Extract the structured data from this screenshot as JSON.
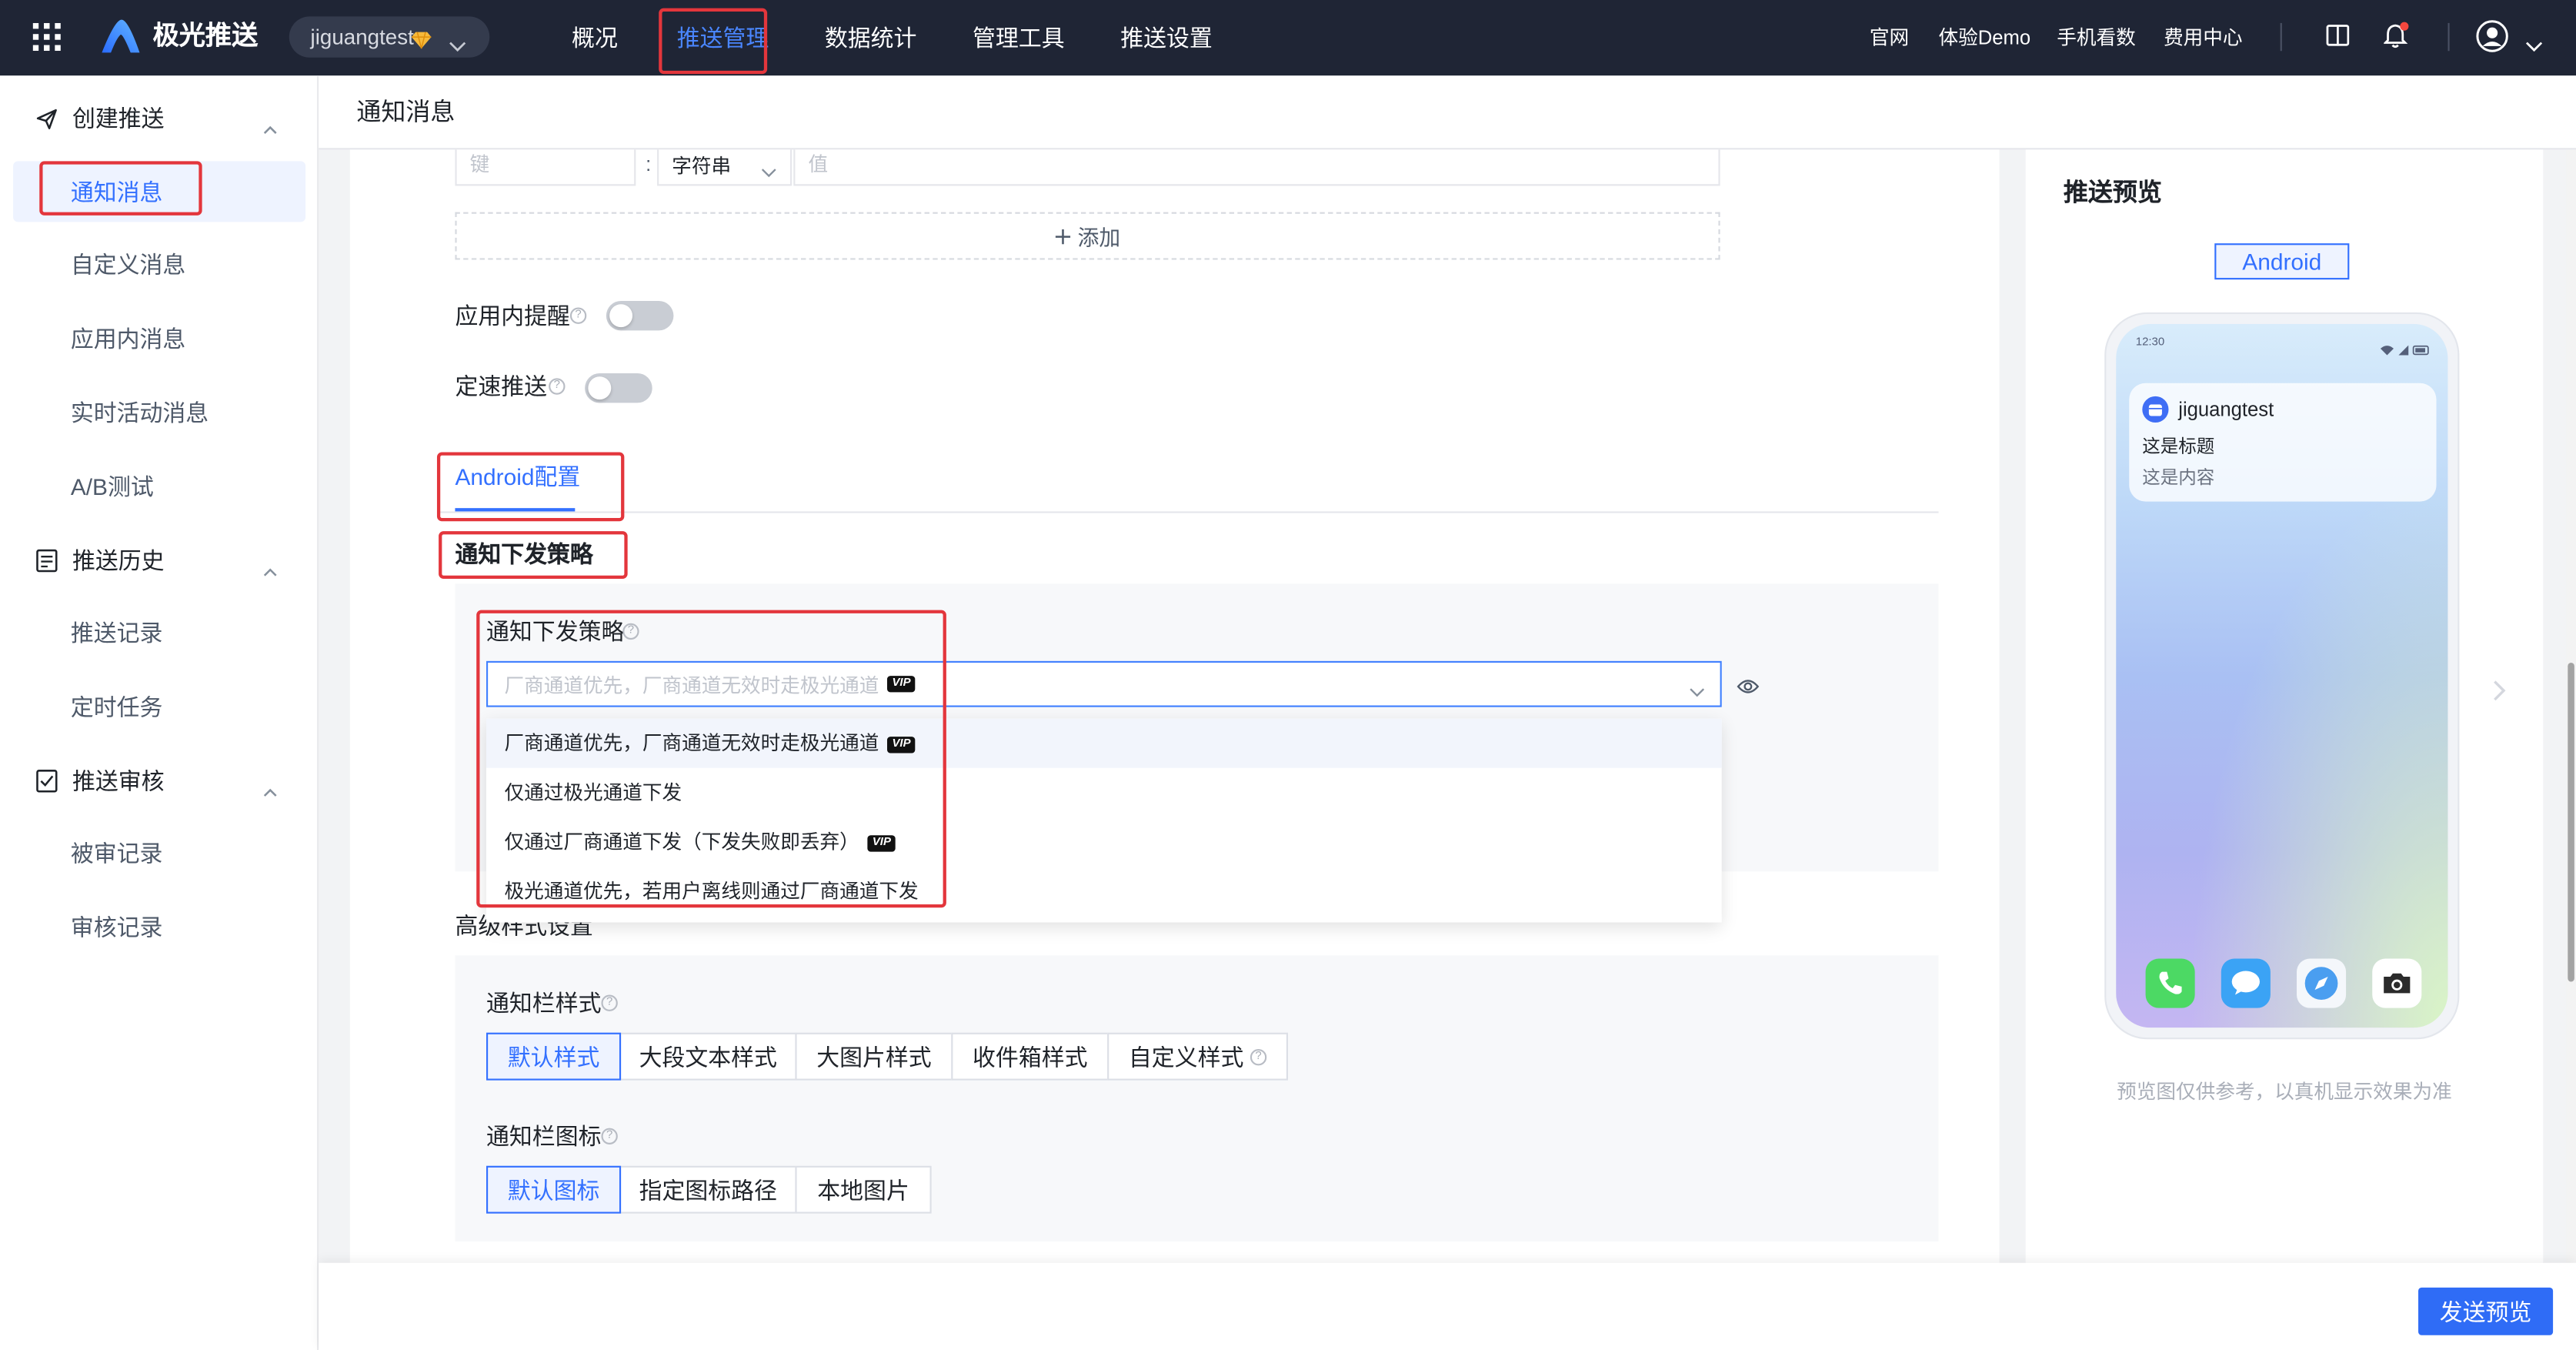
{
  "topbar": {
    "brand": "极光推送",
    "app_selector": {
      "value": "jiguangtest",
      "badge_icon": "gem-icon"
    },
    "nav": [
      {
        "label": "概况"
      },
      {
        "label": "推送管理",
        "active": true
      },
      {
        "label": "数据统计"
      },
      {
        "label": "管理工具"
      },
      {
        "label": "推送设置"
      }
    ],
    "links": [
      "官网",
      "体验Demo",
      "手机看数",
      "费用中心"
    ],
    "icons": [
      "app-grid-icon",
      "layout-panel-icon",
      "bell-icon",
      "user-avatar-icon"
    ]
  },
  "sidebar": {
    "groups": [
      {
        "title": "创建推送",
        "icon": "paper-plane-icon",
        "items": [
          "通知消息",
          "自定义消息",
          "应用内消息",
          "实时活动消息",
          "A/B测试"
        ]
      },
      {
        "title": "推送历史",
        "icon": "history-list-icon",
        "items": [
          "推送记录",
          "定时任务"
        ]
      },
      {
        "title": "推送审核",
        "icon": "review-check-icon",
        "items": [
          "被审记录",
          "审核记录"
        ]
      }
    ],
    "active_item": "通知消息"
  },
  "page": {
    "title": "通知消息"
  },
  "form": {
    "extras_row": {
      "key_placeholder": "键",
      "separator": ":",
      "type": "字符串",
      "value_placeholder": "值"
    },
    "add_label": "添加",
    "in_app_reminder": {
      "label": "应用内提醒",
      "enabled": false
    },
    "rate_push": {
      "label": "定速推送",
      "enabled": false
    },
    "tabs": [
      {
        "label": "Android配置",
        "active": true
      }
    ],
    "strategy_section_title": "通知下发策略",
    "strategy": {
      "label": "通知下发策略",
      "placeholder": "厂商通道优先，厂商通道无效时走极光通道",
      "placeholder_badge": "VIP",
      "options": [
        {
          "text": "厂商通道优先，厂商通道无效时走极光通道",
          "badge": "VIP",
          "hovered": true
        },
        {
          "text": "仅通过极光通道下发"
        },
        {
          "text": "仅通过厂商通道下发（下发失败即丢弃）",
          "badge": "VIP"
        },
        {
          "text": "极光通道优先，若用户离线则通过厂商通道下发"
        }
      ]
    },
    "advanced_title": "高级样式设置",
    "style": {
      "label": "通知栏样式",
      "options": [
        "默认样式",
        "大段文本样式",
        "大图片样式",
        "收件箱样式",
        "自定义样式"
      ],
      "selected": "默认样式"
    },
    "icon": {
      "label": "通知栏图标",
      "options": [
        "默认图标",
        "指定图标路径",
        "本地图片"
      ],
      "selected": "默认图标"
    }
  },
  "preview": {
    "title": "推送预览",
    "platform": "Android",
    "time": "12:30",
    "app_name": "jiguangtest",
    "notif_title": "这是标题",
    "notif_body": "这是内容",
    "note": "预览图仅供参考，以真机显示效果为准",
    "dock_icons": [
      "phone-icon",
      "messages-icon",
      "browser-icon",
      "camera-icon"
    ]
  },
  "footer": {
    "send_preview": "发送预览"
  },
  "colors": {
    "topbar_bg": "#1f2535",
    "brand_blue": "#3370ff",
    "nav_active": "#4a86ff",
    "annotation_red": "#e3363c"
  }
}
